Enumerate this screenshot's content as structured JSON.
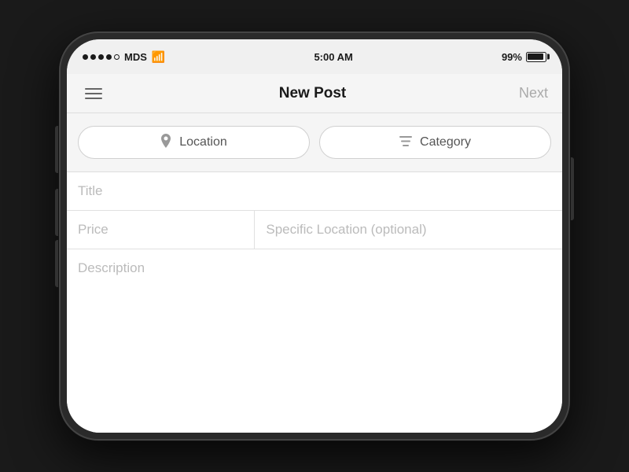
{
  "status_bar": {
    "carrier": "MDS",
    "time": "5:00 AM",
    "battery_percent": "99%",
    "signal_dots": [
      true,
      true,
      true,
      true,
      false
    ]
  },
  "nav": {
    "title": "New Post",
    "next_label": "Next",
    "menu_icon": "hamburger-menu-icon"
  },
  "filters": {
    "location_btn_label": "Location",
    "location_icon": "pin-icon",
    "category_btn_label": "Category",
    "category_icon": "filter-list-icon"
  },
  "form": {
    "title_placeholder": "Title",
    "price_placeholder": "Price",
    "specific_location_placeholder": "Specific Location (optional)",
    "description_placeholder": "Description"
  },
  "colors": {
    "placeholder": "#bbb",
    "border": "#e0e0e0",
    "nav_bg": "#f5f5f5",
    "btn_border": "#d0d0d0"
  }
}
